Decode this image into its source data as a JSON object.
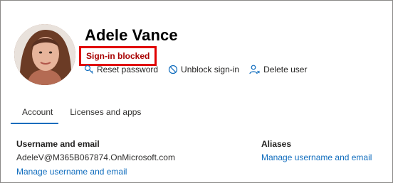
{
  "user": {
    "name": "Adele Vance",
    "status": "Sign-in blocked"
  },
  "actions": [
    {
      "label": "Reset password",
      "icon": "key-icon"
    },
    {
      "label": "Unblock sign-in",
      "icon": "block-icon"
    },
    {
      "label": "Delete user",
      "icon": "delete-user-icon"
    }
  ],
  "tabs": [
    {
      "label": "Account",
      "active": true
    },
    {
      "label": "Licenses and apps",
      "active": false
    }
  ],
  "account": {
    "username_title": "Username and email",
    "username_value": "AdeleV@M365B067874.OnMicrosoft.com",
    "username_link": "Manage username and email",
    "aliases_title": "Aliases",
    "aliases_link": "Manage username and email"
  },
  "colors": {
    "accent": "#0f6cbd",
    "status_border": "#e00000",
    "status_text": "#a80000"
  }
}
